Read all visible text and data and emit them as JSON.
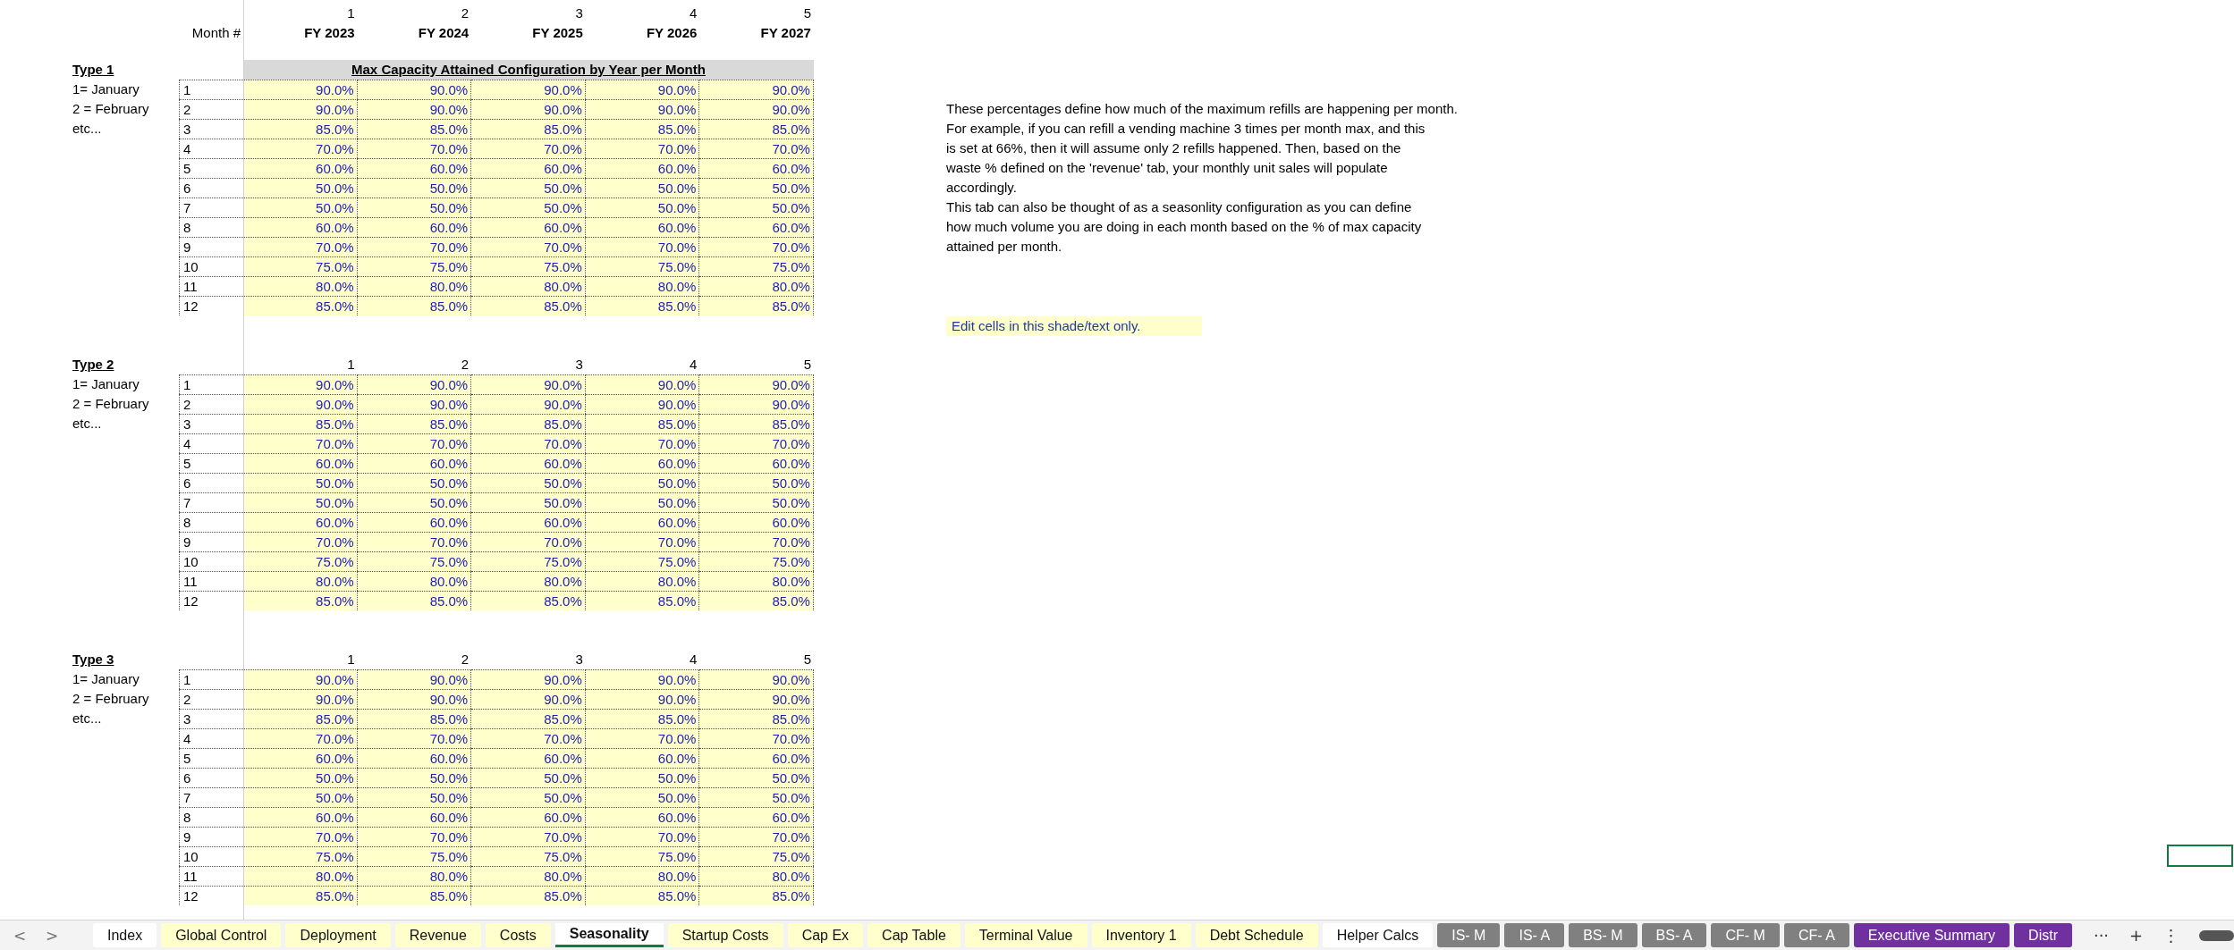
{
  "header": {
    "column_numbers": [
      "1",
      "2",
      "3",
      "4",
      "5"
    ],
    "month_label": "Month #",
    "years": [
      "FY 2023",
      "FY 2024",
      "FY 2025",
      "FY 2026",
      "FY 2027"
    ]
  },
  "sections": [
    {
      "title": "Type 1",
      "banner": "Max Capacity Attained Configuration by Year per Month",
      "legend": [
        "1= January",
        "2 = February",
        "etc..."
      ],
      "rows": [
        {
          "month": "1",
          "values": [
            "90.0%",
            "90.0%",
            "90.0%",
            "90.0%",
            "90.0%"
          ]
        },
        {
          "month": "2",
          "values": [
            "90.0%",
            "90.0%",
            "90.0%",
            "90.0%",
            "90.0%"
          ]
        },
        {
          "month": "3",
          "values": [
            "85.0%",
            "85.0%",
            "85.0%",
            "85.0%",
            "85.0%"
          ]
        },
        {
          "month": "4",
          "values": [
            "70.0%",
            "70.0%",
            "70.0%",
            "70.0%",
            "70.0%"
          ]
        },
        {
          "month": "5",
          "values": [
            "60.0%",
            "60.0%",
            "60.0%",
            "60.0%",
            "60.0%"
          ]
        },
        {
          "month": "6",
          "values": [
            "50.0%",
            "50.0%",
            "50.0%",
            "50.0%",
            "50.0%"
          ]
        },
        {
          "month": "7",
          "values": [
            "50.0%",
            "50.0%",
            "50.0%",
            "50.0%",
            "50.0%"
          ]
        },
        {
          "month": "8",
          "values": [
            "60.0%",
            "60.0%",
            "60.0%",
            "60.0%",
            "60.0%"
          ]
        },
        {
          "month": "9",
          "values": [
            "70.0%",
            "70.0%",
            "70.0%",
            "70.0%",
            "70.0%"
          ]
        },
        {
          "month": "10",
          "values": [
            "75.0%",
            "75.0%",
            "75.0%",
            "75.0%",
            "75.0%"
          ]
        },
        {
          "month": "11",
          "values": [
            "80.0%",
            "80.0%",
            "80.0%",
            "80.0%",
            "80.0%"
          ]
        },
        {
          "month": "12",
          "values": [
            "85.0%",
            "85.0%",
            "85.0%",
            "85.0%",
            "85.0%"
          ]
        }
      ]
    },
    {
      "title": "Type 2",
      "column_numbers": [
        "1",
        "2",
        "3",
        "4",
        "5"
      ],
      "legend": [
        "1= January",
        "2 = February",
        "etc..."
      ],
      "rows": [
        {
          "month": "1",
          "values": [
            "90.0%",
            "90.0%",
            "90.0%",
            "90.0%",
            "90.0%"
          ]
        },
        {
          "month": "2",
          "values": [
            "90.0%",
            "90.0%",
            "90.0%",
            "90.0%",
            "90.0%"
          ]
        },
        {
          "month": "3",
          "values": [
            "85.0%",
            "85.0%",
            "85.0%",
            "85.0%",
            "85.0%"
          ]
        },
        {
          "month": "4",
          "values": [
            "70.0%",
            "70.0%",
            "70.0%",
            "70.0%",
            "70.0%"
          ]
        },
        {
          "month": "5",
          "values": [
            "60.0%",
            "60.0%",
            "60.0%",
            "60.0%",
            "60.0%"
          ]
        },
        {
          "month": "6",
          "values": [
            "50.0%",
            "50.0%",
            "50.0%",
            "50.0%",
            "50.0%"
          ]
        },
        {
          "month": "7",
          "values": [
            "50.0%",
            "50.0%",
            "50.0%",
            "50.0%",
            "50.0%"
          ]
        },
        {
          "month": "8",
          "values": [
            "60.0%",
            "60.0%",
            "60.0%",
            "60.0%",
            "60.0%"
          ]
        },
        {
          "month": "9",
          "values": [
            "70.0%",
            "70.0%",
            "70.0%",
            "70.0%",
            "70.0%"
          ]
        },
        {
          "month": "10",
          "values": [
            "75.0%",
            "75.0%",
            "75.0%",
            "75.0%",
            "75.0%"
          ]
        },
        {
          "month": "11",
          "values": [
            "80.0%",
            "80.0%",
            "80.0%",
            "80.0%",
            "80.0%"
          ]
        },
        {
          "month": "12",
          "values": [
            "85.0%",
            "85.0%",
            "85.0%",
            "85.0%",
            "85.0%"
          ]
        }
      ]
    },
    {
      "title": "Type 3",
      "column_numbers": [
        "1",
        "2",
        "3",
        "4",
        "5"
      ],
      "legend": [
        "1= January",
        "2 = February",
        "etc..."
      ],
      "rows": [
        {
          "month": "1",
          "values": [
            "90.0%",
            "90.0%",
            "90.0%",
            "90.0%",
            "90.0%"
          ]
        },
        {
          "month": "2",
          "values": [
            "90.0%",
            "90.0%",
            "90.0%",
            "90.0%",
            "90.0%"
          ]
        },
        {
          "month": "3",
          "values": [
            "85.0%",
            "85.0%",
            "85.0%",
            "85.0%",
            "85.0%"
          ]
        },
        {
          "month": "4",
          "values": [
            "70.0%",
            "70.0%",
            "70.0%",
            "70.0%",
            "70.0%"
          ]
        },
        {
          "month": "5",
          "values": [
            "60.0%",
            "60.0%",
            "60.0%",
            "60.0%",
            "60.0%"
          ]
        },
        {
          "month": "6",
          "values": [
            "50.0%",
            "50.0%",
            "50.0%",
            "50.0%",
            "50.0%"
          ]
        },
        {
          "month": "7",
          "values": [
            "50.0%",
            "50.0%",
            "50.0%",
            "50.0%",
            "50.0%"
          ]
        },
        {
          "month": "8",
          "values": [
            "60.0%",
            "60.0%",
            "60.0%",
            "60.0%",
            "60.0%"
          ]
        },
        {
          "month": "9",
          "values": [
            "70.0%",
            "70.0%",
            "70.0%",
            "70.0%",
            "70.0%"
          ]
        },
        {
          "month": "10",
          "values": [
            "75.0%",
            "75.0%",
            "75.0%",
            "75.0%",
            "75.0%"
          ]
        },
        {
          "month": "11",
          "values": [
            "80.0%",
            "80.0%",
            "80.0%",
            "80.0%",
            "80.0%"
          ]
        },
        {
          "month": "12",
          "values": [
            "85.0%",
            "85.0%",
            "85.0%",
            "85.0%",
            "85.0%"
          ]
        }
      ]
    }
  ],
  "notes": [
    "These percentages define how much of the maximum refills are happening per month.",
    "For example, if you can refill a vending machine 3 times per month max, and this",
    "is set at 66%, then it will assume only 2 refills happened. Then, based on the",
    "waste % defined on the 'revenue' tab, your monthly unit sales will populate",
    "accordingly.",
    "This tab can also be thought of as a seasonlity configuration as you can define",
    "how much volume you are doing in each month based on the % of max capacity",
    "attained per month."
  ],
  "edit_hint": "Edit cells in this shade/text only.",
  "sheet_nav": [
    "<",
    ">"
  ],
  "sheet_tabs": [
    {
      "label": "Index",
      "selected": false,
      "color": "#ffffff"
    },
    {
      "label": "Global Control",
      "selected": false,
      "color": "#ffffcc"
    },
    {
      "label": "Deployment",
      "selected": false,
      "color": "#ffffcc"
    },
    {
      "label": "Revenue",
      "selected": false,
      "color": "#ffffcc"
    },
    {
      "label": "Costs",
      "selected": false,
      "color": "#ffffcc"
    },
    {
      "label": "Seasonality",
      "selected": true,
      "color": "#ffffff"
    },
    {
      "label": "Startup Costs",
      "selected": false,
      "color": "#ffffcc"
    },
    {
      "label": "Cap Ex",
      "selected": false,
      "color": "#ffffcc"
    },
    {
      "label": "Cap Table",
      "selected": false,
      "color": "#ffffcc"
    },
    {
      "label": "Terminal Value",
      "selected": false,
      "color": "#ffffcc"
    },
    {
      "label": "Inventory 1",
      "selected": false,
      "color": "#ffffcc"
    },
    {
      "label": "Debt Schedule",
      "selected": false,
      "color": "#ffffcc"
    },
    {
      "label": "Helper Calcs",
      "selected": false,
      "color": "#ffffff"
    },
    {
      "label": "IS- M",
      "selected": false,
      "color": "#808080"
    },
    {
      "label": "IS- A",
      "selected": false,
      "color": "#808080"
    },
    {
      "label": "BS- M",
      "selected": false,
      "color": "#808080"
    },
    {
      "label": "BS- A",
      "selected": false,
      "color": "#808080"
    },
    {
      "label": "CF- M",
      "selected": false,
      "color": "#808080"
    },
    {
      "label": "CF- A",
      "selected": false,
      "color": "#808080"
    },
    {
      "label": "Executive Summary",
      "selected": false,
      "color": "#7030a0"
    },
    {
      "label": "Distr",
      "selected": false,
      "color": "#7030a0"
    }
  ],
  "tab_actions": [
    "···",
    "+",
    "⋮"
  ]
}
